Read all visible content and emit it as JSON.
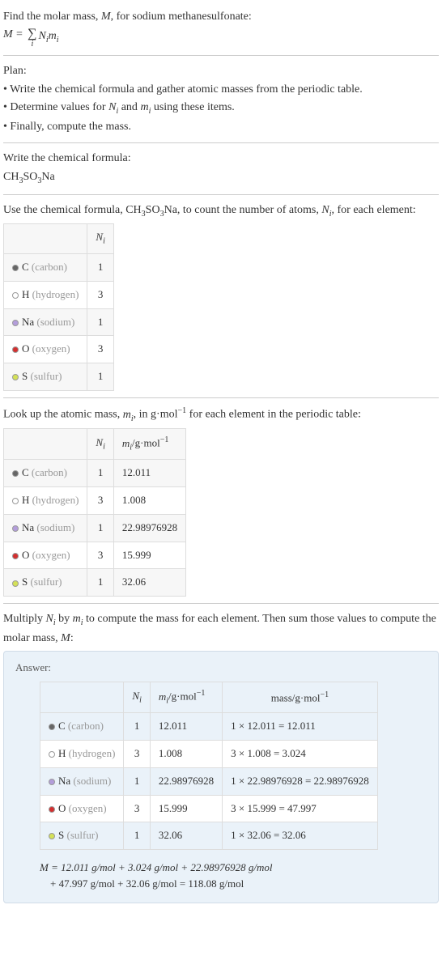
{
  "intro": {
    "line1": "Find the molar mass, ",
    "var_m": "M",
    "line1_sep": ", for sodium methanesulfonate:",
    "sum_below": "i",
    "term_n": "N",
    "term_m": "m"
  },
  "plan": {
    "heading": "Plan:",
    "b1": "Write the chemical formula and gather atomic masses from the periodic table.",
    "b2_a": "Determine values for ",
    "b2_b": " and ",
    "b2_c": " using these items.",
    "b3": "Finally, compute the mass."
  },
  "step1": {
    "heading": "Write the chemical formula:",
    "formula_1": "CH",
    "formula_sub1": "3",
    "formula_2": "SO",
    "formula_sub2": "3",
    "formula_3": "Na"
  },
  "step2": {
    "text_a": "Use the chemical formula, CH",
    "sub1": "3",
    "text_b": "SO",
    "sub2": "3",
    "text_c": "Na, to count the number of atoms, ",
    "var_n": "N",
    "var_i": "i",
    "text_d": ", for each element:",
    "col_n": "N",
    "col_n_sub": "i"
  },
  "elements": [
    {
      "dot": "dot-c",
      "sym": "C",
      "name": "(carbon)",
      "n": "1",
      "m": "12.011",
      "mass": "1 × 12.011 = 12.011"
    },
    {
      "dot": "dot-h",
      "sym": "H",
      "name": "(hydrogen)",
      "n": "3",
      "m": "1.008",
      "mass": "3 × 1.008 = 3.024"
    },
    {
      "dot": "dot-na",
      "sym": "Na",
      "name": "(sodium)",
      "n": "1",
      "m": "22.98976928",
      "mass": "1 × 22.98976928 = 22.98976928"
    },
    {
      "dot": "dot-o",
      "sym": "O",
      "name": "(oxygen)",
      "n": "3",
      "m": "15.999",
      "mass": "3 × 15.999 = 47.997"
    },
    {
      "dot": "dot-s",
      "sym": "S",
      "name": "(sulfur)",
      "n": "1",
      "m": "32.06",
      "mass": "1 × 32.06 = 32.06"
    }
  ],
  "step3": {
    "text_a": "Look up the atomic mass, ",
    "var_m": "m",
    "var_i": "i",
    "text_b": ", in g·mol",
    "sup": "−1",
    "text_c": " for each element in the periodic table:",
    "col_m": "m",
    "col_m_sub": "i",
    "col_m_unit": "/g·mol"
  },
  "step4": {
    "text_a": "Multiply ",
    "text_b": " by ",
    "text_c": " to compute the mass for each element. Then sum those values to compute the molar mass, ",
    "var_big_m": "M",
    "text_d": ":"
  },
  "answer": {
    "label": "Answer:",
    "col_mass": "mass/g·mol",
    "col_mass_sup": "−1",
    "final_l1": "M = 12.011 g/mol + 3.024 g/mol + 22.98976928 g/mol",
    "final_l2": "+ 47.997 g/mol + 32.06 g/mol = 118.08 g/mol"
  }
}
